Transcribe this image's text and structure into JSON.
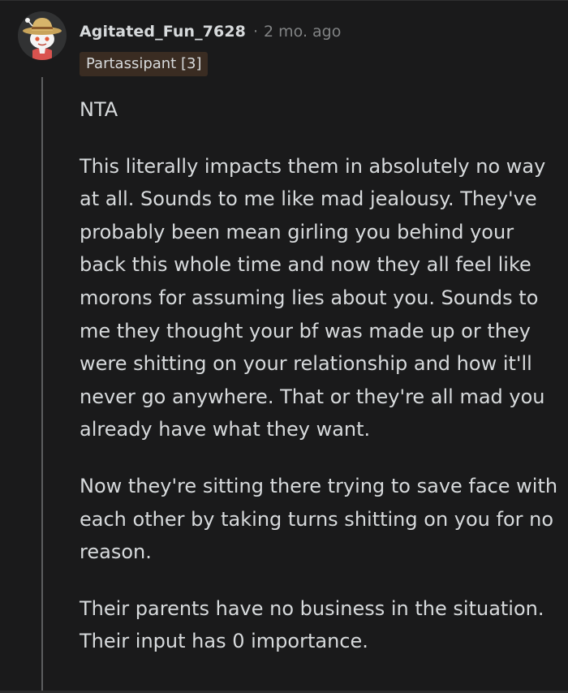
{
  "comment": {
    "author": "Agitated_Fun_7628",
    "separator": "·",
    "timestamp": "2 mo. ago",
    "flair": "Partassipant [3]",
    "avatar_icon": "snoo-cowboy-hat-avatar-icon",
    "paragraphs": [
      "NTA",
      "This literally impacts them in absolutely no way at all. Sounds to me like mad jealousy. They've probably been mean girling you behind your back this whole time and now they all feel like morons for assuming lies about you. Sounds to me they thought your bf was made up or they were shitting on your relationship and how it'll never go anywhere. That or they're all mad you already have what they want.",
      "Now they're sitting there trying to save face with each other by taking turns shitting on you for no reason.",
      "Their parents have no business in the situation. Their input has 0 importance."
    ]
  },
  "colors": {
    "background": "#1a1a1b",
    "text": "#d7dadc",
    "meta_text": "#818384",
    "flair_background": "#3a2c22",
    "thread_line": "#5d5e60"
  }
}
